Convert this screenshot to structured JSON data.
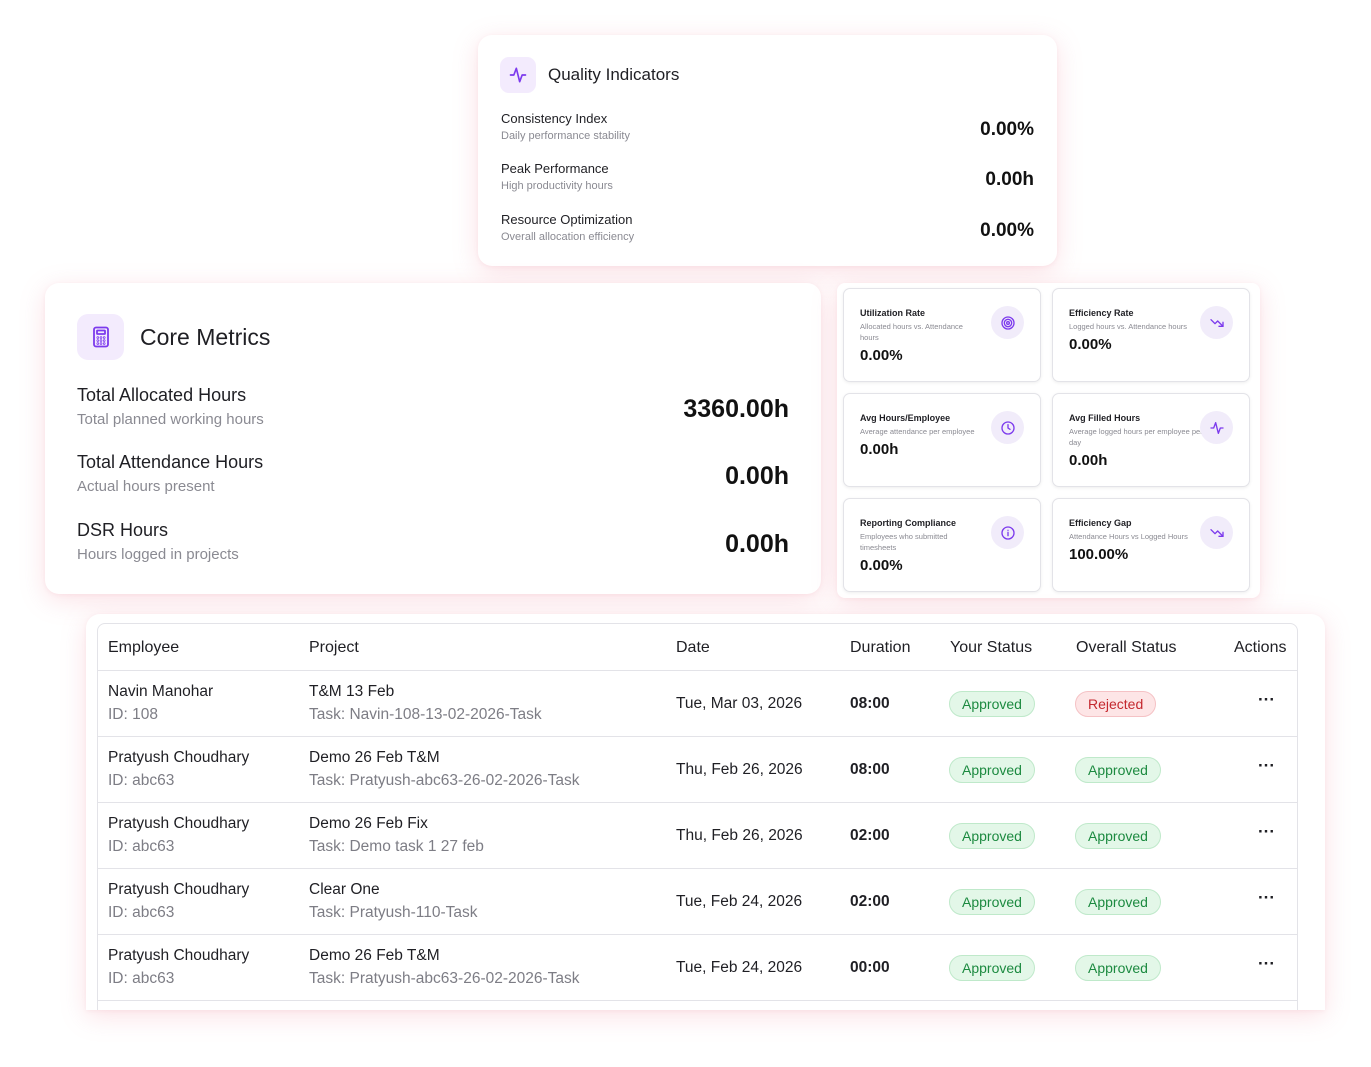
{
  "quality": {
    "title": "Quality Indicators",
    "icon": "activity-icon",
    "rows": [
      {
        "name": "Consistency Index",
        "desc": "Daily performance stability",
        "value": "0.00%"
      },
      {
        "name": "Peak Performance",
        "desc": "High productivity hours",
        "value": "0.00h"
      },
      {
        "name": "Resource Optimization",
        "desc": "Overall allocation efficiency",
        "value": "0.00%"
      }
    ]
  },
  "core": {
    "title": "Core Metrics",
    "icon": "calculator-icon",
    "rows": [
      {
        "name": "Total Allocated Hours",
        "desc": "Total planned working hours",
        "value": "3360.00h"
      },
      {
        "name": "Total Attendance Hours",
        "desc": "Actual hours present",
        "value": "0.00h"
      },
      {
        "name": "DSR Hours",
        "desc": "Hours logged in projects",
        "value": "0.00h"
      }
    ]
  },
  "tiles": [
    {
      "name": "Utilization Rate",
      "desc": "Allocated hours vs. Attendance hours",
      "value": "0.00%",
      "icon": "target-icon"
    },
    {
      "name": "Efficiency Rate",
      "desc": "Logged hours vs. Attendance hours",
      "value": "0.00%",
      "icon": "trending-down-icon"
    },
    {
      "name": "Avg Hours/Employee",
      "desc": "Average attendance per employee",
      "value": "0.00h",
      "icon": "clock-icon"
    },
    {
      "name": "Avg Filled Hours",
      "desc": "Average logged hours per employee per day",
      "value": "0.00h",
      "icon": "activity-icon"
    },
    {
      "name": "Reporting Compliance",
      "desc": "Employees who submitted timesheets",
      "value": "0.00%",
      "icon": "info-icon"
    },
    {
      "name": "Efficiency Gap",
      "desc": "Attendance Hours vs Logged Hours",
      "value": "100.00%",
      "icon": "trending-down-icon"
    }
  ],
  "table": {
    "headers": {
      "employee": "Employee",
      "project": "Project",
      "date": "Date",
      "duration": "Duration",
      "your_status": "Your Status",
      "overall_status": "Overall Status",
      "actions": "Actions"
    },
    "rows": [
      {
        "employee": "Navin Manohar",
        "id": "ID: 108",
        "project": "T&M 13 Feb",
        "task": "Task: Navin-108-13-02-2026-Task",
        "date": "Tue, Mar 03, 2026",
        "duration": "08:00",
        "your_status": "Approved",
        "overall_status": "Rejected",
        "actions": "···"
      },
      {
        "employee": "Pratyush Choudhary",
        "id": "ID: abc63",
        "project": "Demo 26 Feb T&M",
        "task": "Task: Pratyush-abc63-26-02-2026-Task",
        "date": "Thu, Feb 26, 2026",
        "duration": "08:00",
        "your_status": "Approved",
        "overall_status": "Approved",
        "actions": "···"
      },
      {
        "employee": "Pratyush Choudhary",
        "id": "ID: abc63",
        "project": "Demo 26 Feb Fix",
        "task": "Task: Demo task 1 27 feb",
        "date": "Thu, Feb 26, 2026",
        "duration": "02:00",
        "your_status": "Approved",
        "overall_status": "Approved",
        "actions": "···"
      },
      {
        "employee": "Pratyush Choudhary",
        "id": "ID: abc63",
        "project": "Clear One",
        "task": "Task: Pratyush-110-Task",
        "date": "Tue, Feb 24, 2026",
        "duration": "02:00",
        "your_status": "Approved",
        "overall_status": "Approved",
        "actions": "···"
      },
      {
        "employee": "Pratyush Choudhary",
        "id": "ID: abc63",
        "project": "Demo 26 Feb T&M",
        "task": "Task: Pratyush-abc63-26-02-2026-Task",
        "date": "Tue, Feb 24, 2026",
        "duration": "00:00",
        "your_status": "Approved",
        "overall_status": "Approved",
        "actions": "···"
      }
    ]
  },
  "colors": {
    "accent": "#7c3aed",
    "accent_bg": "#f3ebfd",
    "approved": "#1c8a40",
    "rejected": "#c4282e"
  }
}
